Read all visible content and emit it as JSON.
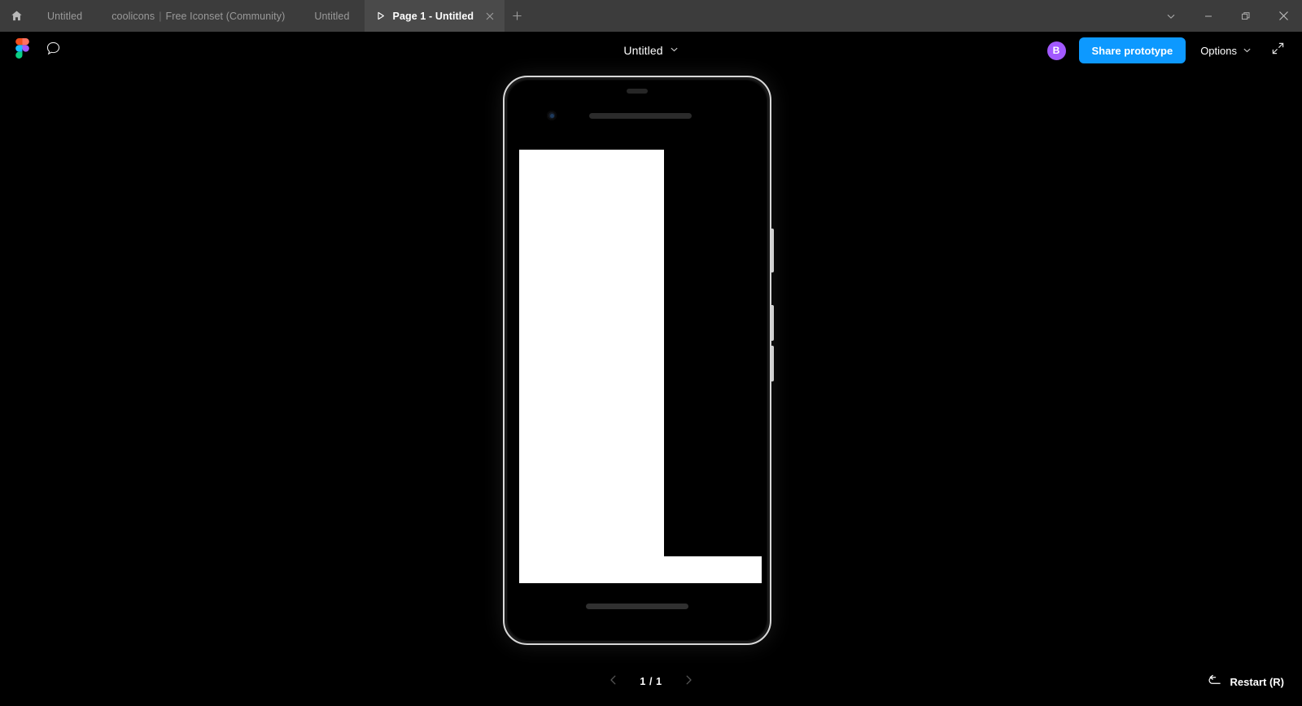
{
  "window": {
    "home_icon": "home-icon",
    "tabs": [
      {
        "title": "Untitled",
        "active": false,
        "has_play_icon": false
      },
      {
        "title": "coolicons",
        "separator": "|",
        "title2": "Free Iconset (Community)",
        "active": false,
        "has_play_icon": false
      },
      {
        "title": "Untitled",
        "active": false,
        "has_play_icon": false
      },
      {
        "title": "Page 1 - Untitled",
        "active": true,
        "has_play_icon": true
      }
    ],
    "new_tab_label": "+",
    "controls": [
      {
        "name": "tab-list-chevron",
        "glyph": "chevron-down"
      },
      {
        "name": "minimize",
        "glyph": "minus"
      },
      {
        "name": "maximize-restore",
        "glyph": "restore"
      },
      {
        "name": "close",
        "glyph": "x"
      }
    ]
  },
  "toolbar": {
    "logo": "figma-logo",
    "comment_icon": "comment-bubble-icon",
    "file_title": "Untitled",
    "file_title_chevron": "chevron-down-icon",
    "avatar_initial": "B",
    "avatar_color": "#a259ff",
    "share_label": "Share prototype",
    "share_color": "#0d99ff",
    "options_label": "Options",
    "options_chevron": "chevron-down-icon",
    "fullscreen_icon": "expand-diagonal-icon"
  },
  "prototype": {
    "device": "google-pixel-2",
    "frame_background": "#000000",
    "shape_color": "#ffffff"
  },
  "bottombar": {
    "prev_label": "chevron-left-icon",
    "page_indicator": "1 / 1",
    "next_label": "chevron-right-icon",
    "restart_icon": "restart-arrow-icon",
    "restart_label": "Restart (R)"
  }
}
